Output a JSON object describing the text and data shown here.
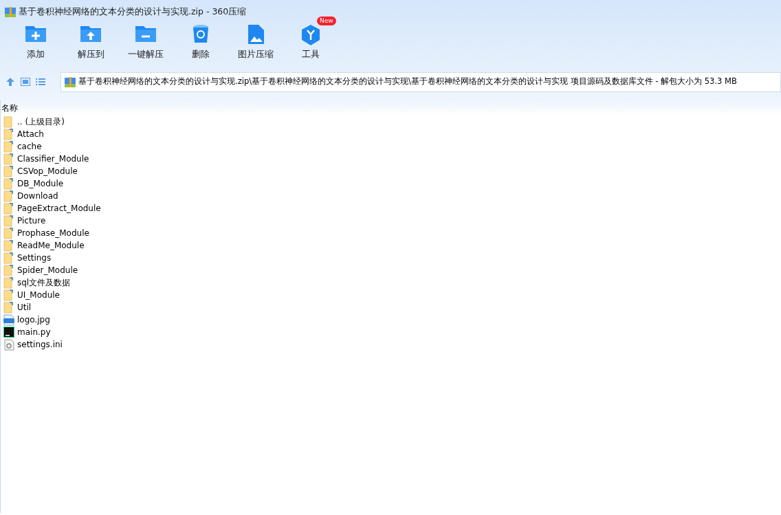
{
  "window": {
    "title": "基于卷积神经网络的文本分类的设计与实现.zip - 360压缩"
  },
  "toolbar": [
    {
      "label": "添加",
      "kind": "add"
    },
    {
      "label": "解压到",
      "kind": "extract-to"
    },
    {
      "label": "一键解压",
      "kind": "extract"
    },
    {
      "label": "删除",
      "kind": "delete"
    },
    {
      "label": "图片压缩",
      "kind": "image"
    },
    {
      "label": "工具",
      "kind": "tools",
      "badge": "New"
    }
  ],
  "address": {
    "path": "基于卷积神经网络的文本分类的设计与实现.zip\\基于卷积神经网络的文本分类的设计与实现\\基于卷积神经网络的文本分类的设计与实现 项目源码及数据库文件 - 解包大小为 53.3 MB"
  },
  "file_list": {
    "columns": [
      "名称"
    ],
    "items": [
      {
        "name": ".. (上级目录)",
        "kind": "parent"
      },
      {
        "name": "Attach",
        "kind": "folder"
      },
      {
        "name": "cache",
        "kind": "folder"
      },
      {
        "name": "Classifier_Module",
        "kind": "folder"
      },
      {
        "name": "CSVop_Module",
        "kind": "folder"
      },
      {
        "name": "DB_Module",
        "kind": "folder"
      },
      {
        "name": "Download",
        "kind": "folder"
      },
      {
        "name": "PageExtract_Module",
        "kind": "folder"
      },
      {
        "name": "Picture",
        "kind": "folder"
      },
      {
        "name": "Prophase_Module",
        "kind": "folder"
      },
      {
        "name": "ReadMe_Module",
        "kind": "folder"
      },
      {
        "name": "Settings",
        "kind": "folder"
      },
      {
        "name": "Spider_Module",
        "kind": "folder"
      },
      {
        "name": "sql文件及数据",
        "kind": "folder"
      },
      {
        "name": "UI_Module",
        "kind": "folder"
      },
      {
        "name": "Util",
        "kind": "folder"
      },
      {
        "name": "logo.jpg",
        "kind": "image"
      },
      {
        "name": "main.py",
        "kind": "python"
      },
      {
        "name": "settings.ini",
        "kind": "settings"
      }
    ]
  }
}
